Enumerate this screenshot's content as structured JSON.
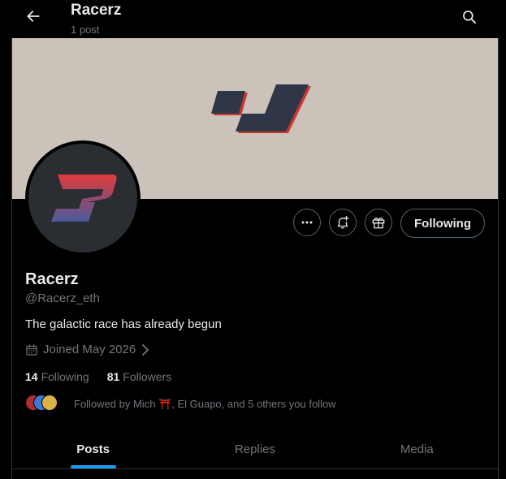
{
  "header": {
    "title": "Racerz",
    "subtitle": "1 post",
    "back_icon": "arrow-left-icon",
    "search_icon": "search-icon"
  },
  "banner": {
    "logo_icon": "racerz-checkmark-logo-icon",
    "background_color": "#cbc3ba"
  },
  "avatar": {
    "logo_icon": "racerz-r-logo-icon"
  },
  "actions": {
    "more_icon": "more-horizontal-icon",
    "notify_icon": "bell-plus-icon",
    "gift_icon": "gift-icon",
    "following_label": "Following"
  },
  "profile": {
    "name": "Racerz",
    "handle": "@Racerz_eth",
    "bio": "The galactic race has already begun",
    "joined": "Joined May 2026",
    "following_count": "14",
    "following_label": "Following",
    "followers_count": "81",
    "followers_label": "Followers",
    "followed_by": "Followed by Mich ⛩️, El Guapo, and 5 others you follow"
  },
  "tabs": [
    {
      "label": "Posts",
      "active": true
    },
    {
      "label": "Replies",
      "active": false
    },
    {
      "label": "Media",
      "active": false
    }
  ],
  "colors": {
    "accent": "#1d9bf0",
    "text": "#e7e9ea",
    "muted": "#71767b",
    "border": "#2f3336"
  }
}
